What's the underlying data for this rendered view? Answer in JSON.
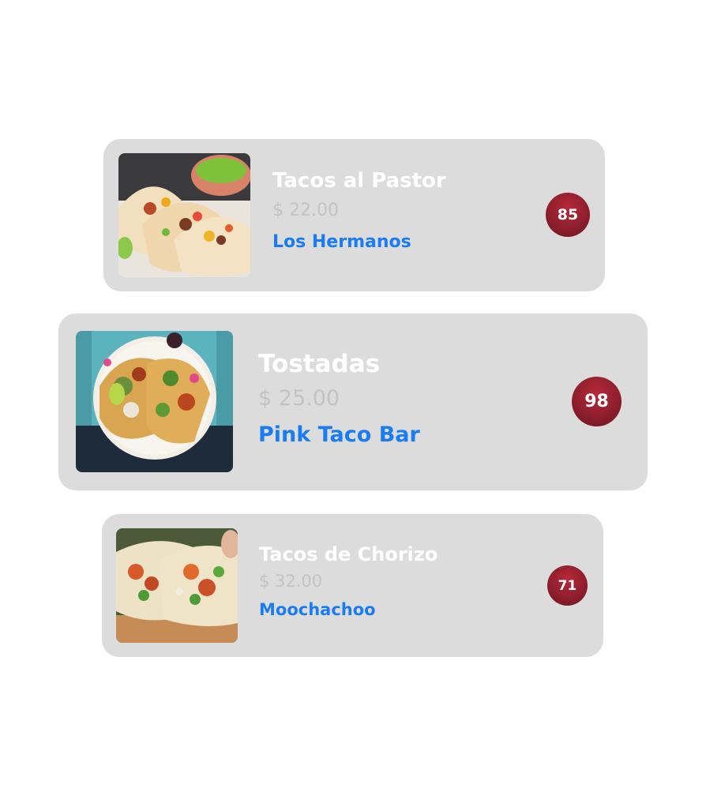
{
  "items": [
    {
      "name": "Tacos al Pastor",
      "price": "$ 22.00",
      "restaurant": "Los Hermanos",
      "score": "85"
    },
    {
      "name": "Tostadas",
      "price": "$ 25.00",
      "restaurant": "Pink Taco Bar",
      "score": "98"
    },
    {
      "name": "Tacos de Chorizo",
      "price": "$ 32.00",
      "restaurant": "Moochachoo",
      "score": "71"
    }
  ],
  "colors": {
    "card_background": "#dcdcdc",
    "name_text": "#ffffff",
    "price_text": "#c3c3c3",
    "restaurant_link": "#1a7cf0",
    "score_badge": "#8e1f2c"
  }
}
